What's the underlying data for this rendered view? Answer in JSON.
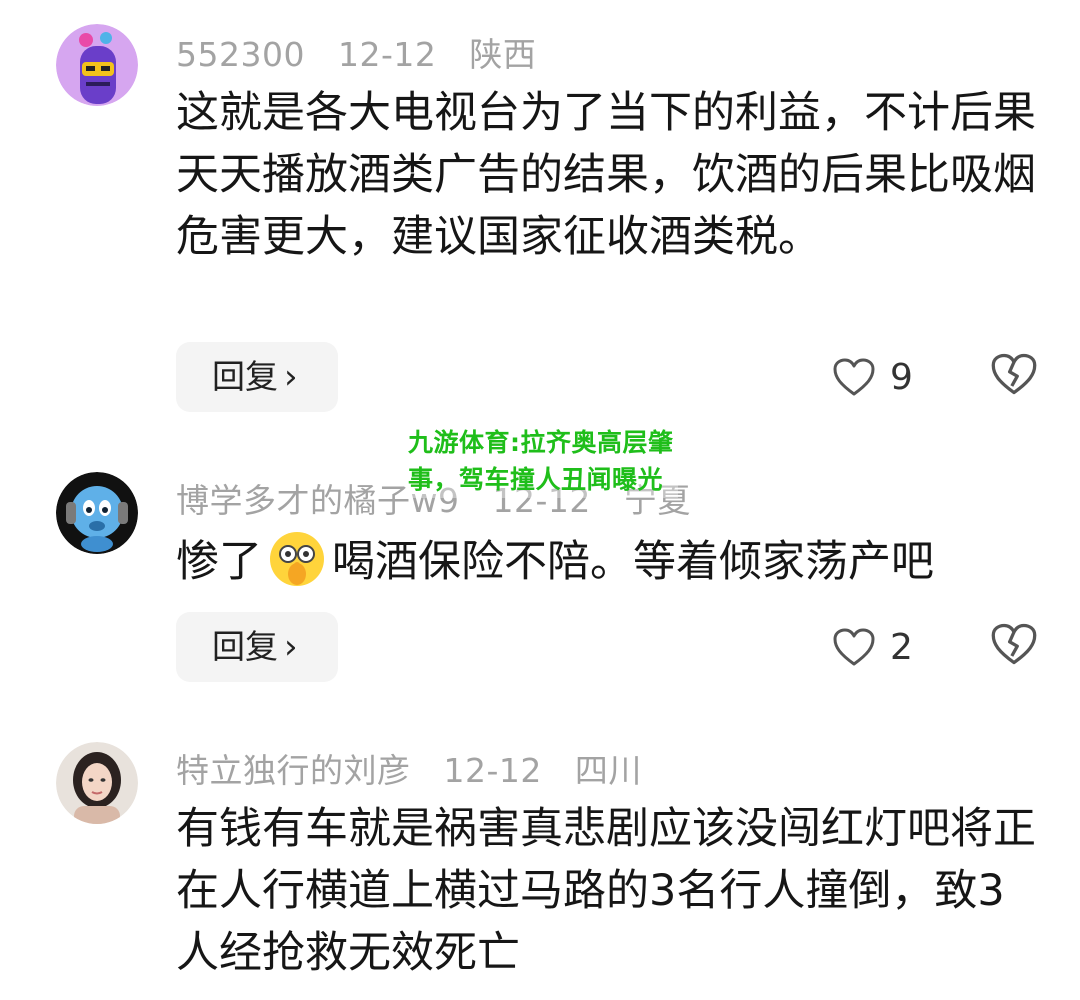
{
  "comments": [
    {
      "username": "552300",
      "date": "12-12",
      "location": "陕西",
      "text": "这就是各大电视台为了当下的利益，不计后果天天播放酒类广告的结果，饮酒的后果比吸烟危害更大，建议国家征收酒类税。",
      "reply_label": "回复",
      "likes": "9",
      "avatar_icon": "purple-cartoon-avatar"
    },
    {
      "username": "博学多才的橘子w9",
      "date": "12-12",
      "location": "宁夏",
      "text_before": "惨了",
      "emoji_icon": "shushing-face-emoji",
      "text_after": "喝酒保险不陪。等着倾家荡产吧",
      "reply_label": "回复",
      "likes": "2",
      "avatar_icon": "blue-headphone-avatar"
    },
    {
      "username": "特立独行的刘彦",
      "date": "12-12",
      "location": "四川",
      "text": "有钱有车就是祸害真悲剧应该没闯红灯吧将正在人行横道上横过马路的3名行人撞倒，致3人经抢救无效死亡",
      "avatar_icon": "woman-photo-avatar"
    }
  ],
  "watermark": "九游体育:拉齐奥高层肇事，驾车撞人丑闻曝光",
  "colors": {
    "meta": "#a3a3a3",
    "text": "#161616",
    "reply_bg": "#f4f4f4",
    "watermark": "#1fbe1a"
  }
}
